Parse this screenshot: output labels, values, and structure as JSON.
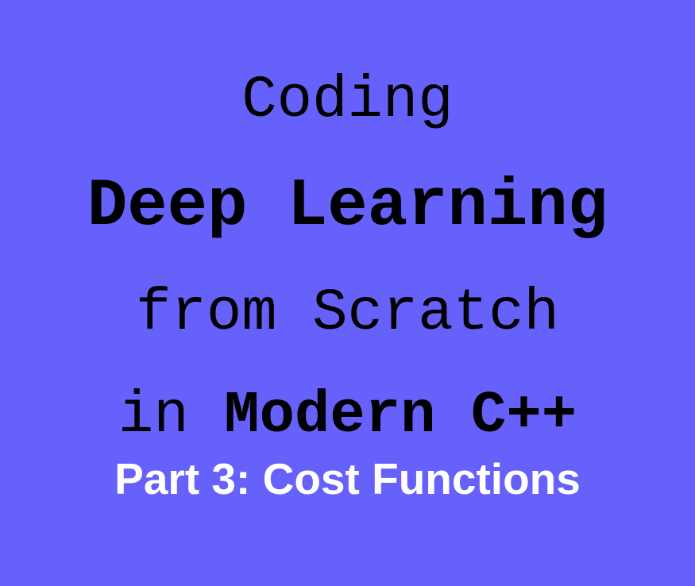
{
  "title": {
    "line1": "Coding",
    "line2": "Deep Learning",
    "line3": "from Scratch",
    "line4_prefix": "in ",
    "line4_bold": "Modern C++"
  },
  "subtitle": "Part 3: Cost Functions",
  "colors": {
    "background": "#6561fa",
    "title_text": "#000000",
    "subtitle_text": "#ffffff"
  }
}
